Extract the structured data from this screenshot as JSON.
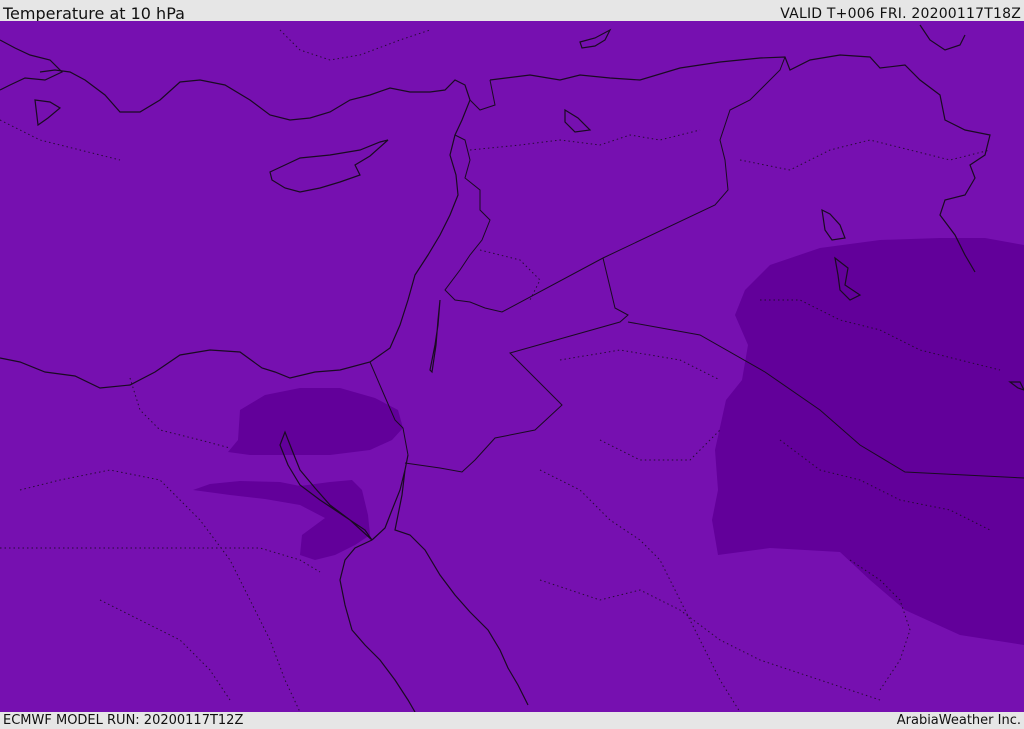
{
  "header": {
    "title": "Temperature at 10 hPa",
    "valid": "VALID T+006 FRI. 20200117T18Z"
  },
  "footer": {
    "model_run": "ECMWF MODEL RUN: 20200117T12Z",
    "credit": "ArabiaWeather Inc."
  },
  "map": {
    "colors": {
      "field_base": "#7610b0",
      "field_cold": "#62009a",
      "coastline": "#1a0a22",
      "border": "#1a0a22"
    }
  }
}
